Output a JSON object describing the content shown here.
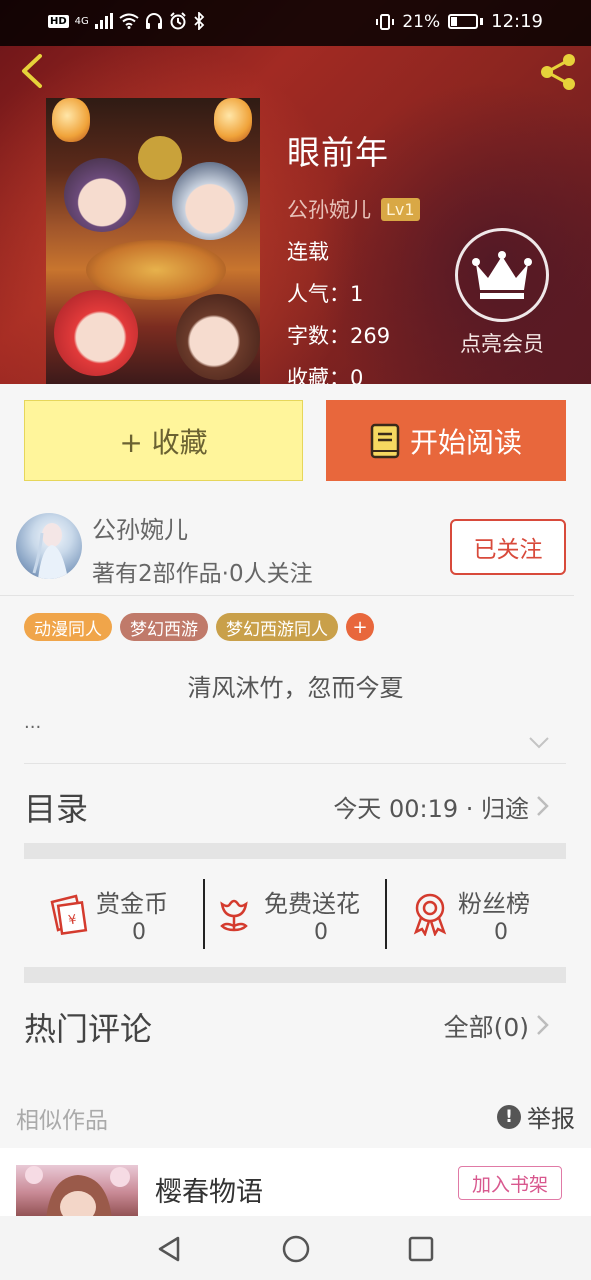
{
  "status_bar": {
    "hd": "HD",
    "network": "4G",
    "battery": "21%",
    "time": "12:19"
  },
  "book": {
    "title": "眼前年",
    "author": "公孙婉儿",
    "level": "Lv1",
    "status": "连载",
    "popularity": "人气：1",
    "word_count": "字数：269",
    "favorites": "收藏：0"
  },
  "vip": {
    "label": "点亮会员",
    "icon": "crown-icon"
  },
  "actions": {
    "collect_label": "+ 收藏",
    "read_label": "开始阅读",
    "read_icon": "book-icon"
  },
  "author_card": {
    "name": "公孙婉儿",
    "stats": "著有2部作品·0人关注",
    "follow_label": "已关注"
  },
  "tags": [
    {
      "label": "动漫同人",
      "color": "#f0a54a"
    },
    {
      "label": "梦幻西游",
      "color": "#c07a6a"
    },
    {
      "label": "梦幻西游同人",
      "color": "#c9a04a"
    }
  ],
  "tags_more": "+",
  "intro": {
    "text": "清风沐竹，忽而今夏",
    "ellipsis": "..."
  },
  "catalog": {
    "title": "目录",
    "latest": "今天 00:19 · 归途"
  },
  "stats": [
    {
      "label": "赏金币",
      "value": "0",
      "icon": "red-envelope-icon"
    },
    {
      "label": "免费送花",
      "value": "0",
      "icon": "flower-icon"
    },
    {
      "label": "粉丝榜",
      "value": "0",
      "icon": "award-ribbon-icon"
    }
  ],
  "comments": {
    "title": "热门评论",
    "all_label": "全部(0)"
  },
  "similar": {
    "title": "相似作品",
    "report_label": "举报",
    "report_icon": "!",
    "item_title": "樱春物语",
    "add_shelf_label": "加入书架"
  },
  "colors": {
    "accent_orange": "#e8673c",
    "collect_yellow": "#fff59b",
    "follow_red": "#d84a3b",
    "hero_red": "#a22a23"
  }
}
